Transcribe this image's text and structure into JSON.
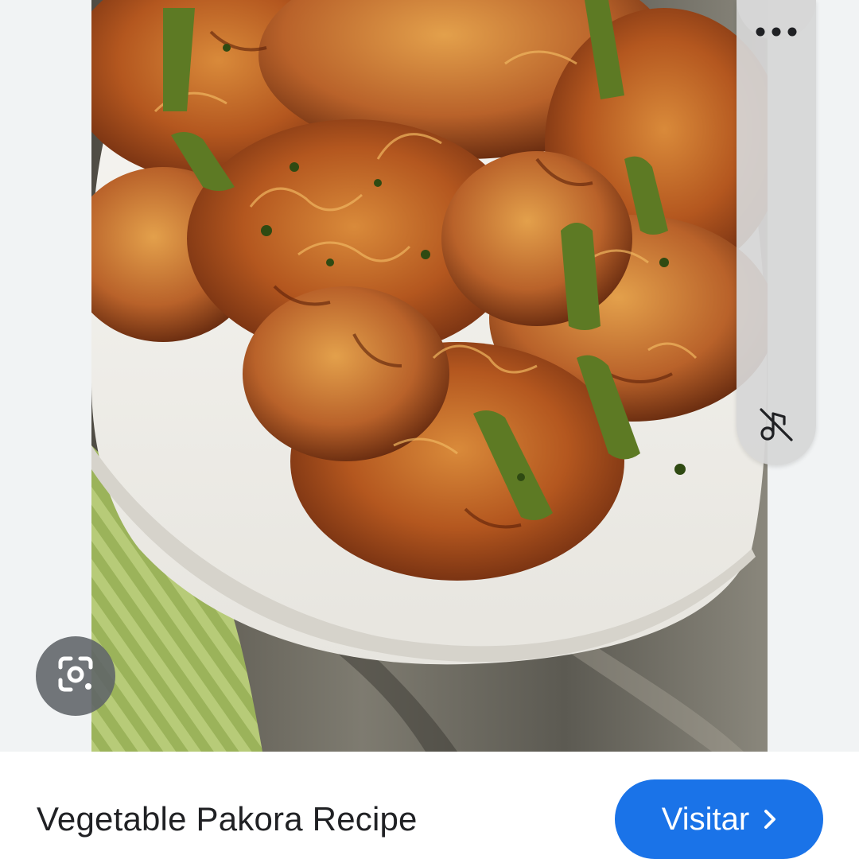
{
  "image": {
    "subject": "vegetable-pakora-photo"
  },
  "overlay": {
    "more_icon": "more-horizontal-icon",
    "mute_icon": "sound-off-icon",
    "lens_icon": "google-lens-icon"
  },
  "result": {
    "title": "Vegetable Pakora Recipe",
    "visit_label": "Visitar",
    "visit_icon": "chevron-right-icon"
  },
  "colors": {
    "accent": "#1a73e8",
    "bar_bg": "#ffffff",
    "text": "#202124",
    "page_bg": "#f1f3f4"
  }
}
